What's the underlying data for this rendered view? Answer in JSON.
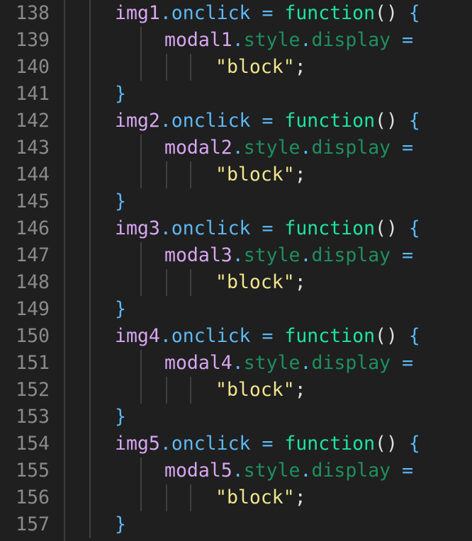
{
  "editor": {
    "colors": {
      "background": "#1f1f1f",
      "line_number": "#8a8a8a",
      "variable": "#d7a6f2",
      "property": "#5cb8f5",
      "property_dim": "#1f8f5f",
      "keyword": "#1fe3a0",
      "string": "#f0e68c",
      "punctuation": "#dfdfdf"
    },
    "lines": [
      {
        "n": "138",
        "kind": "open",
        "obj": "img1",
        "prop": "onclick",
        "eq": "=",
        "kw": "function",
        "paren": "()",
        "brace": "{"
      },
      {
        "n": "139",
        "kind": "assign",
        "obj": "modal1",
        "dot1": ".",
        "p1": "style",
        "dot2": ".",
        "p2": "display",
        "eq": "="
      },
      {
        "n": "140",
        "kind": "str",
        "str": "\"block\"",
        "semi": ";"
      },
      {
        "n": "141",
        "kind": "close",
        "brace": "}"
      },
      {
        "n": "142",
        "kind": "open",
        "obj": "img2",
        "prop": "onclick",
        "eq": "=",
        "kw": "function",
        "paren": "()",
        "brace": "{"
      },
      {
        "n": "143",
        "kind": "assign",
        "obj": "modal2",
        "dot1": ".",
        "p1": "style",
        "dot2": ".",
        "p2": "display",
        "eq": "="
      },
      {
        "n": "144",
        "kind": "str",
        "str": "\"block\"",
        "semi": ";"
      },
      {
        "n": "145",
        "kind": "close",
        "brace": "}"
      },
      {
        "n": "146",
        "kind": "open",
        "obj": "img3",
        "prop": "onclick",
        "eq": "=",
        "kw": "function",
        "paren": "()",
        "brace": "{"
      },
      {
        "n": "147",
        "kind": "assign",
        "obj": "modal3",
        "dot1": ".",
        "p1": "style",
        "dot2": ".",
        "p2": "display",
        "eq": "="
      },
      {
        "n": "148",
        "kind": "str",
        "str": "\"block\"",
        "semi": ";"
      },
      {
        "n": "149",
        "kind": "close",
        "brace": "}"
      },
      {
        "n": "150",
        "kind": "open",
        "obj": "img4",
        "prop": "onclick",
        "eq": "=",
        "kw": "function",
        "paren": "()",
        "brace": "{"
      },
      {
        "n": "151",
        "kind": "assign",
        "obj": "modal4",
        "dot1": ".",
        "p1": "style",
        "dot2": ".",
        "p2": "display",
        "eq": "="
      },
      {
        "n": "152",
        "kind": "str",
        "str": "\"block\"",
        "semi": ";"
      },
      {
        "n": "153",
        "kind": "close",
        "brace": "}"
      },
      {
        "n": "154",
        "kind": "open",
        "obj": "img5",
        "prop": "onclick",
        "eq": "=",
        "kw": "function",
        "paren": "()",
        "brace": "{"
      },
      {
        "n": "155",
        "kind": "assign",
        "obj": "modal5",
        "dot1": ".",
        "p1": "style",
        "dot2": ".",
        "p2": "display",
        "eq": "="
      },
      {
        "n": "156",
        "kind": "str",
        "str": "\"block\"",
        "semi": ";"
      },
      {
        "n": "157",
        "kind": "close",
        "brace": "}"
      }
    ]
  }
}
